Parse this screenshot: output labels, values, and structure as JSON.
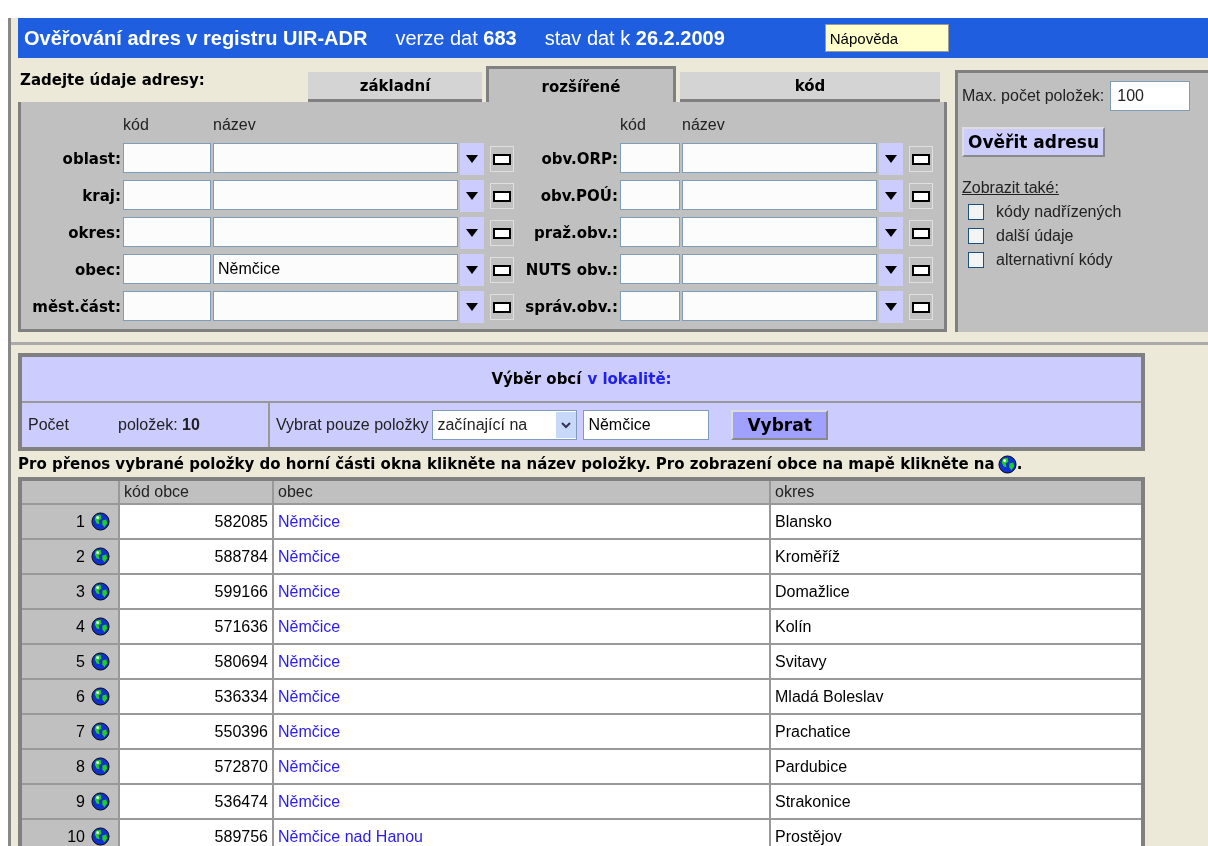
{
  "header": {
    "title": "Ověřování adres v registru UIR-ADR",
    "version": "verze dat **683**",
    "state": "stav dat k **26.2.2009**",
    "help_button": "Nápověda"
  },
  "form": {
    "prompt": "Zadejte údaje adresy:",
    "tabs": [
      {
        "label": "základní",
        "selected": false
      },
      {
        "label": "rozšířené",
        "selected": true
      },
      {
        "label": "kód",
        "selected": false
      }
    ],
    "columns": [
      {
        "code_header": "kód",
        "name_header": "název",
        "fields": [
          {
            "label": "oblast:"
          },
          {
            "label": "kraj:"
          },
          {
            "label": "okres:"
          },
          {
            "label": "obec:",
            "name_value": "Němčice"
          },
          {
            "label": "měst.část:"
          }
        ]
      },
      {
        "code_header": "kód",
        "name_header": "název",
        "fields": [
          {
            "label": "obv.ORP:"
          },
          {
            "label": "obv.POÚ:"
          },
          {
            "label": "praž.obv.:"
          },
          {
            "label": "NUTS obv.:"
          },
          {
            "label": "správ.obv.:"
          }
        ]
      }
    ]
  },
  "options": {
    "max_label": "Max. počet položek:",
    "max_value": "100",
    "verify_button": "Ověřit adresu",
    "show_also": "Zobrazit také:",
    "checkboxes": [
      {
        "label": "kódy nadřízených",
        "checked": false
      },
      {
        "label": "další údaje",
        "checked": false
      },
      {
        "label": "alternativní kódy",
        "checked": false
      }
    ]
  },
  "selection": {
    "title": "Výběr obcí",
    "title_link": "v lokalitě:",
    "count_label": "Počet",
    "count": "položek: **10**",
    "filter_label": "Vybrat pouze položky",
    "filter_mode": "začínající na",
    "filter_value": "Němčice",
    "button": "Vybrat"
  },
  "instruction": "Pro přenos vybrané položky do horní části okna klikněte na název položky. Pro zobrazení obce na mapě klikněte na",
  "instruction_end": ".",
  "table": {
    "columns": [
      "kód obce",
      "obec",
      "okres"
    ],
    "rows": [
      {
        "number": "1",
        "code": "582085",
        "obec": "Němčice",
        "okres": "Blansko"
      },
      {
        "number": "2",
        "code": "588784",
        "obec": "Němčice",
        "okres": "Kroměříž"
      },
      {
        "number": "3",
        "code": "599166",
        "obec": "Němčice",
        "okres": "Domažlice"
      },
      {
        "number": "4",
        "code": "571636",
        "obec": "Němčice",
        "okres": "Kolín"
      },
      {
        "number": "5",
        "code": "580694",
        "obec": "Němčice",
        "okres": "Svitavy"
      },
      {
        "number": "6",
        "code": "536334",
        "obec": "Němčice",
        "okres": "Mladá Boleslav"
      },
      {
        "number": "7",
        "code": "550396",
        "obec": "Němčice",
        "okres": "Prachatice"
      },
      {
        "number": "8",
        "code": "572870",
        "obec": "Němčice",
        "okres": "Pardubice"
      },
      {
        "number": "9",
        "code": "536474",
        "obec": "Němčice",
        "okres": "Strakonice"
      },
      {
        "number": "10",
        "code": "589756",
        "obec": "Němčice nad Hanou",
        "okres": "Prostějov"
      }
    ]
  }
}
